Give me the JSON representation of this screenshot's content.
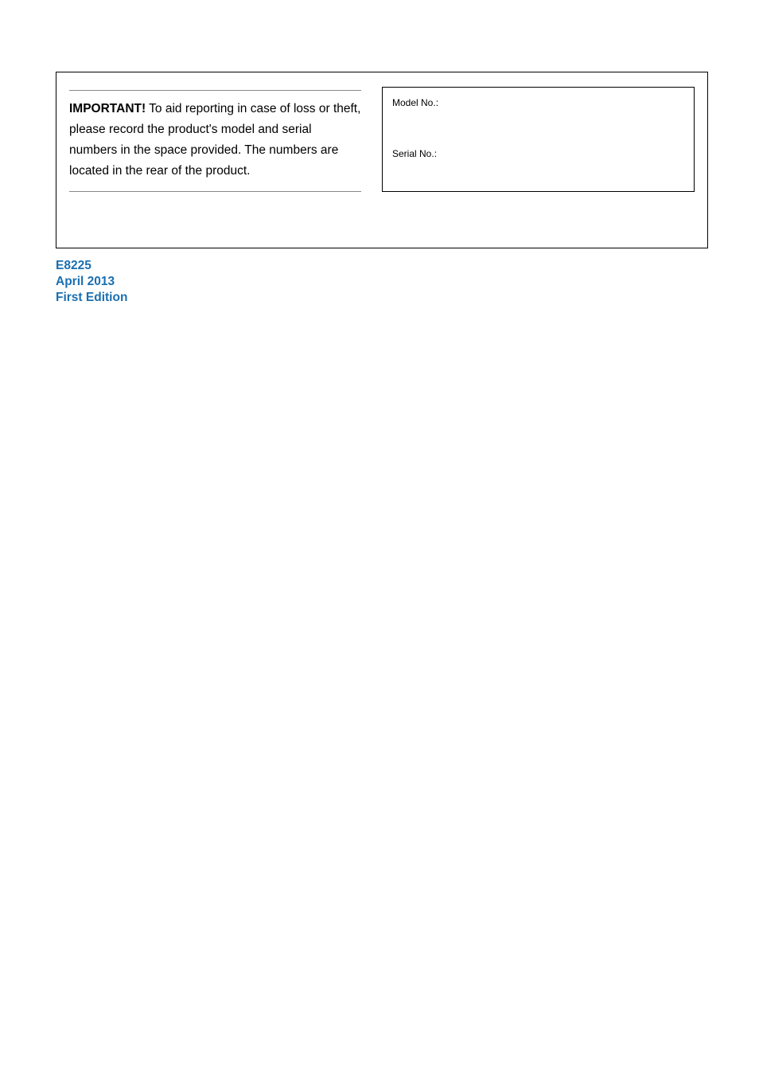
{
  "importantBox": {
    "label": "IMPORTANT!",
    "text": " To aid reporting in case of loss or theft, please record the product's model and serial numbers in the space provided. The numbers are located in the rear of the product."
  },
  "recordFields": {
    "modelLabel": "Model No.:",
    "serialLabel": "Serial No.:"
  },
  "docInfo": {
    "code": "E8225",
    "date": "April 2013",
    "edition": "First Edition"
  }
}
